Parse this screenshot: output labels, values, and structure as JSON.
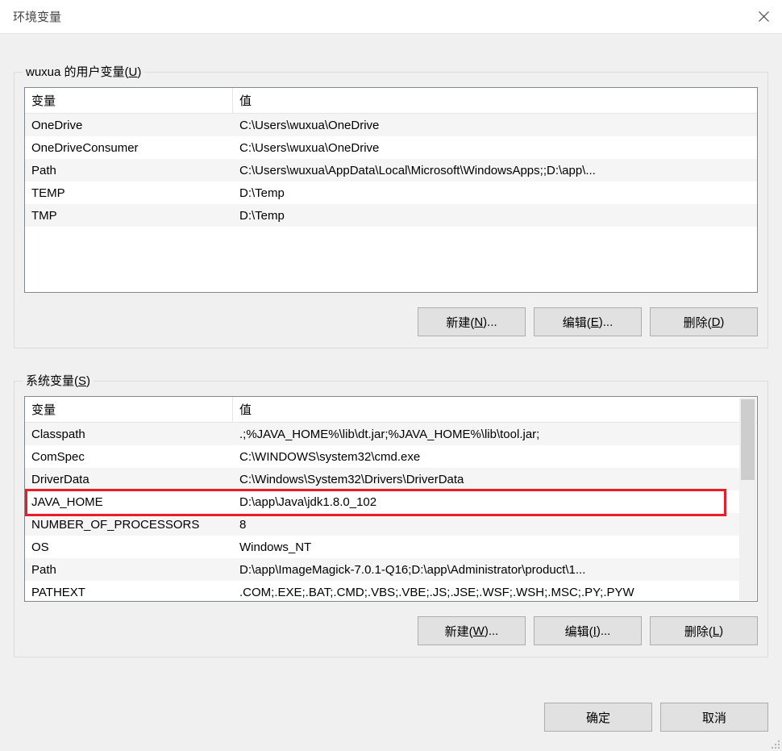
{
  "window": {
    "title": "环境变量"
  },
  "user_group": {
    "legend_prefix": "wuxua 的用户变量(",
    "legend_accel": "U",
    "legend_suffix": ")",
    "headers": {
      "variable": "变量",
      "value": "值"
    },
    "rows": [
      {
        "name": "OneDrive",
        "value": "C:\\Users\\wuxua\\OneDrive"
      },
      {
        "name": "OneDriveConsumer",
        "value": "C:\\Users\\wuxua\\OneDrive"
      },
      {
        "name": "Path",
        "value": "C:\\Users\\wuxua\\AppData\\Local\\Microsoft\\WindowsApps;;D:\\app\\..."
      },
      {
        "name": "TEMP",
        "value": "D:\\Temp"
      },
      {
        "name": "TMP",
        "value": "D:\\Temp"
      }
    ],
    "buttons": {
      "new": {
        "label": "新建(",
        "accel": "N",
        "suffix": ")..."
      },
      "edit": {
        "label": "编辑(",
        "accel": "E",
        "suffix": ")..."
      },
      "delete": {
        "label": "删除(",
        "accel": "D",
        "suffix": ")"
      }
    }
  },
  "system_group": {
    "legend_prefix": "系统变量(",
    "legend_accel": "S",
    "legend_suffix": ")",
    "headers": {
      "variable": "变量",
      "value": "值"
    },
    "rows": [
      {
        "name": "Classpath",
        "value": ".;%JAVA_HOME%\\lib\\dt.jar;%JAVA_HOME%\\lib\\tool.jar;"
      },
      {
        "name": "ComSpec",
        "value": "C:\\WINDOWS\\system32\\cmd.exe"
      },
      {
        "name": "DriverData",
        "value": "C:\\Windows\\System32\\Drivers\\DriverData"
      },
      {
        "name": "JAVA_HOME",
        "value": "D:\\app\\Java\\jdk1.8.0_102"
      },
      {
        "name": "NUMBER_OF_PROCESSORS",
        "value": "8"
      },
      {
        "name": "OS",
        "value": "Windows_NT"
      },
      {
        "name": "Path",
        "value": "D:\\app\\ImageMagick-7.0.1-Q16;D:\\app\\Administrator\\product\\1..."
      },
      {
        "name": "PATHEXT",
        "value": ".COM;.EXE;.BAT;.CMD;.VBS;.VBE;.JS;.JSE;.WSF;.WSH;.MSC;.PY;.PYW"
      }
    ],
    "buttons": {
      "new": {
        "label": "新建(",
        "accel": "W",
        "suffix": ")..."
      },
      "edit": {
        "label": "编辑(",
        "accel": "I",
        "suffix": ")..."
      },
      "delete": {
        "label": "删除(",
        "accel": "L",
        "suffix": ")"
      }
    }
  },
  "footer": {
    "ok": "确定",
    "cancel": "取消"
  }
}
